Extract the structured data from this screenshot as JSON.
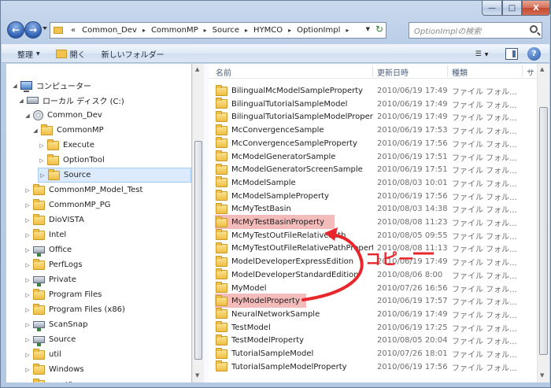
{
  "window": {
    "min_label": "—",
    "max_label": "□",
    "close_label": "X"
  },
  "address": {
    "crumbs": [
      "Common_Dev",
      "CommonMP",
      "Source",
      "HYMCO",
      "OptionImpl"
    ],
    "prefix": "«"
  },
  "search": {
    "placeholder": "OptionImplの検索"
  },
  "toolbar": {
    "organize": "整理",
    "open": "開く",
    "new_folder": "新しいフォルダー"
  },
  "columns": {
    "name": "名前",
    "date": "更新日時",
    "type": "種類",
    "size": "サ"
  },
  "tree": [
    {
      "label": "コンピューター",
      "icon": "computer",
      "depth": 0,
      "expanded": true
    },
    {
      "label": "ローカル ディスク (C:)",
      "icon": "drive",
      "depth": 1,
      "expanded": true
    },
    {
      "label": "Common_Dev",
      "icon": "disc",
      "depth": 2,
      "expanded": true
    },
    {
      "label": "CommonMP",
      "icon": "folder",
      "depth": 3,
      "expanded": true
    },
    {
      "label": "Execute",
      "icon": "folder",
      "depth": 4,
      "expanded": false
    },
    {
      "label": "OptionTool",
      "icon": "folder",
      "depth": 4,
      "expanded": false
    },
    {
      "label": "Source",
      "icon": "folder",
      "depth": 4,
      "expanded": false,
      "selected": true
    },
    {
      "label": "CommonMP_Model_Test",
      "icon": "folder",
      "depth": 2,
      "expanded": false
    },
    {
      "label": "CommonMP_PG",
      "icon": "folder",
      "depth": 2,
      "expanded": false
    },
    {
      "label": "DioVISTA",
      "icon": "folder",
      "depth": 2,
      "expanded": false
    },
    {
      "label": "Intel",
      "icon": "folder",
      "depth": 2,
      "expanded": false
    },
    {
      "label": "Office",
      "icon": "netdrive",
      "depth": 2,
      "expanded": false
    },
    {
      "label": "PerfLogs",
      "icon": "folder",
      "depth": 2,
      "expanded": false
    },
    {
      "label": "Private",
      "icon": "netdrive",
      "depth": 2,
      "expanded": false
    },
    {
      "label": "Program Files",
      "icon": "folder",
      "depth": 2,
      "expanded": false
    },
    {
      "label": "Program Files (x86)",
      "icon": "folder",
      "depth": 2,
      "expanded": false
    },
    {
      "label": "ScanSnap",
      "icon": "netdrive",
      "depth": 2,
      "expanded": false
    },
    {
      "label": "Source",
      "icon": "netdrive",
      "depth": 2,
      "expanded": false
    },
    {
      "label": "util",
      "icon": "folder",
      "depth": 2,
      "expanded": false
    },
    {
      "label": "Windows",
      "icon": "folder",
      "depth": 2,
      "expanded": false
    },
    {
      "label": "ユーザー",
      "icon": "folder",
      "depth": 2,
      "expanded": false
    }
  ],
  "files": [
    {
      "name": "BilingualMcModelSampleProperty",
      "date": "2010/06/19 17:49",
      "type": "ファイル フォル..."
    },
    {
      "name": "BilingualTutorialSampleModel",
      "date": "2010/06/19 17:49",
      "type": "ファイル フォル..."
    },
    {
      "name": "BilingualTutorialSampleModelProperty",
      "date": "2010/06/19 17:49",
      "type": "ファイル フォル..."
    },
    {
      "name": "McConvergenceSample",
      "date": "2010/06/19 17:53",
      "type": "ファイル フォル..."
    },
    {
      "name": "McConvergenceSampleProperty",
      "date": "2010/06/19 17:56",
      "type": "ファイル フォル..."
    },
    {
      "name": "McModelGeneratorSample",
      "date": "2010/06/19 17:51",
      "type": "ファイル フォル..."
    },
    {
      "name": "McModelGeneratorScreenSample",
      "date": "2010/06/19 17:51",
      "type": "ファイル フォル..."
    },
    {
      "name": "McModelSample",
      "date": "2010/08/03 10:01",
      "type": "ファイル フォル..."
    },
    {
      "name": "McModelSampleProperty",
      "date": "2010/06/19 17:56",
      "type": "ファイル フォル..."
    },
    {
      "name": "McMyTestBasin",
      "date": "2010/08/03 14:38",
      "type": "ファイル フォル..."
    },
    {
      "name": "McMyTestBasinProperty",
      "date": "2010/08/08 11:23",
      "type": "ファイル フォル...",
      "highlight": true
    },
    {
      "name": "McMyTestOutFileRelativePath",
      "date": "2010/08/05 09:55",
      "type": "ファイル フォル..."
    },
    {
      "name": "McMyTestOutFileRelativePathProperty",
      "date": "2010/08/08 11:13",
      "type": "ファイル フォル..."
    },
    {
      "name": "ModelDeveloperExpressEdition",
      "date": "2010/06/19 17:49",
      "type": "ファイル フォル..."
    },
    {
      "name": "ModelDeveloperStandardEdition",
      "date": "2010/08/06 8:00",
      "type": "ファイル フォル..."
    },
    {
      "name": "MyModel",
      "date": "2010/07/26 16:56",
      "type": "ファイル フォル..."
    },
    {
      "name": "MyModelProperty",
      "date": "2010/06/19 17:57",
      "type": "ファイル フォル...",
      "highlight": true
    },
    {
      "name": "NeuralNetworkSample",
      "date": "2010/06/19 17:49",
      "type": "ファイル フォル..."
    },
    {
      "name": "TestModel",
      "date": "2010/06/19 17:25",
      "type": "ファイル フォル..."
    },
    {
      "name": "TestModelProperty",
      "date": "2010/08/05 20:04",
      "type": "ファイル フォル..."
    },
    {
      "name": "TutorialSampleModel",
      "date": "2010/07/26 18:01",
      "type": "ファイル フォル..."
    },
    {
      "name": "TutorialSampleModelProperty",
      "date": "2010/06/19 17:56",
      "type": "ファイル フォル..."
    }
  ],
  "annotation": {
    "label": "コピー",
    "color": "#e8262b"
  },
  "colors": {
    "highlight": "#e14b4b",
    "selection": "#dbeafc",
    "folder": "#efbe45"
  }
}
